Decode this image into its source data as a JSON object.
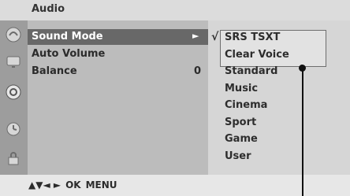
{
  "menu": {
    "title": "Audio",
    "items": [
      {
        "label": "Sound Mode",
        "value": "",
        "selected": true
      },
      {
        "label": "Auto Volume",
        "value": "",
        "selected": false
      },
      {
        "label": "Balance",
        "value": "0",
        "selected": false
      }
    ],
    "submenu_arrow": "►"
  },
  "submenu": {
    "check": "√",
    "options": [
      "SRS TSXT",
      "Clear Voice",
      "Standard",
      "Music",
      "Cinema",
      "Sport",
      "Game",
      "User"
    ]
  },
  "footer": {
    "arrows": "▲▼◄ ►",
    "ok": "OK",
    "menu": "MENU"
  },
  "icons": [
    "picture-icon",
    "tv-icon",
    "audio-icon",
    "clock-icon",
    "lock-icon"
  ]
}
